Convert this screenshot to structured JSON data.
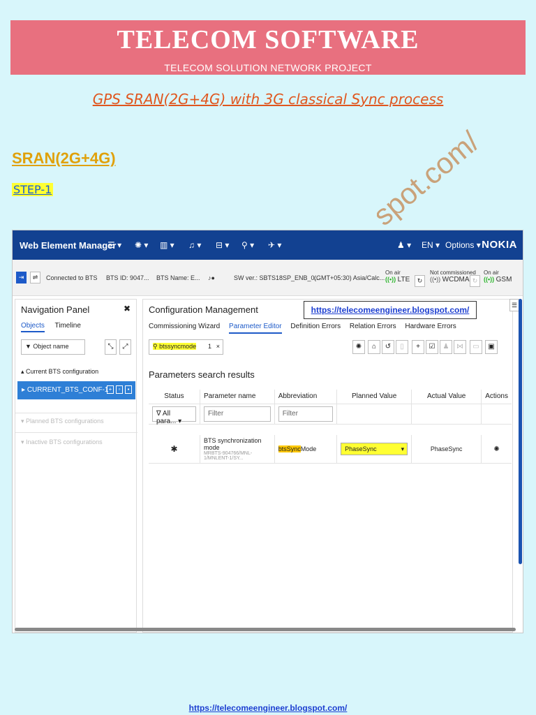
{
  "banner": {
    "title": "TELECOM SOFTWARE",
    "subtitle": "TELECOM SOLUTION NETWORK PROJECT"
  },
  "heading": "GPS SRAN(2G+4G) with 3G classical Sync process",
  "section": "SRAN(2G+4G)",
  "step": "STEP-1",
  "watermark": "spot.com/",
  "app": {
    "title": "Web Element Manager",
    "lang": "EN ▾",
    "options": "Options ▾",
    "brand": "NOKIA",
    "connected": "Connected to BTS",
    "bts_id": "BTS ID: 9047...",
    "bts_name": "BTS Name: E...",
    "sw_ver": "SW ver.: SBTS18SP_ENB_0...",
    "timezone": "(GMT+05:30) Asia/Calc...",
    "lte": {
      "label": "On air",
      "value": "LTE"
    },
    "wcdma": {
      "label": "Not commissioned",
      "value": "WCDMA"
    },
    "gsm": {
      "label": "On air",
      "value": "GSM"
    }
  },
  "nav": {
    "title": "Navigation Panel",
    "tab_objects": "Objects",
    "tab_timeline": "Timeline",
    "filter_placeholder": "Object name",
    "current_section": "Current BTS configuration",
    "current_item": "CURRENT_BTS_CONF-1",
    "planned": "Planned BTS configurations",
    "inactive": "Inactive BTS configurations"
  },
  "cfg": {
    "title": "Configuration Management",
    "url": "https://telecomeengineer.blogspot.com/",
    "tabs": [
      "Commissioning Wizard",
      "Parameter Editor",
      "Definition Errors",
      "Relation Errors",
      "Hardware Errors"
    ],
    "search_value": "btssyncmode",
    "search_count": "1",
    "results_title": "Parameters search results",
    "columns": [
      "Status",
      "Parameter name",
      "Abbreviation",
      "Planned Value",
      "Actual Value",
      "Actions"
    ],
    "filter_status": "All para...",
    "filter_placeholder": "Filter",
    "row": {
      "status": "✱",
      "name": "BTS synchronization mode",
      "path": "MRBTS-904766/MNL-1/MNLENT-1/SY...",
      "abbr_hl": "btsSync",
      "abbr_rest": "Mode",
      "planned": "PhaseSync",
      "actual": "PhaseSync"
    }
  },
  "footer_url": "https://telecomeengineer.blogspot.com/",
  "colors": {
    "banner": "#e8707f",
    "background": "#d8f6fb",
    "topbar": "#124191",
    "highlight": "#ffff33"
  }
}
